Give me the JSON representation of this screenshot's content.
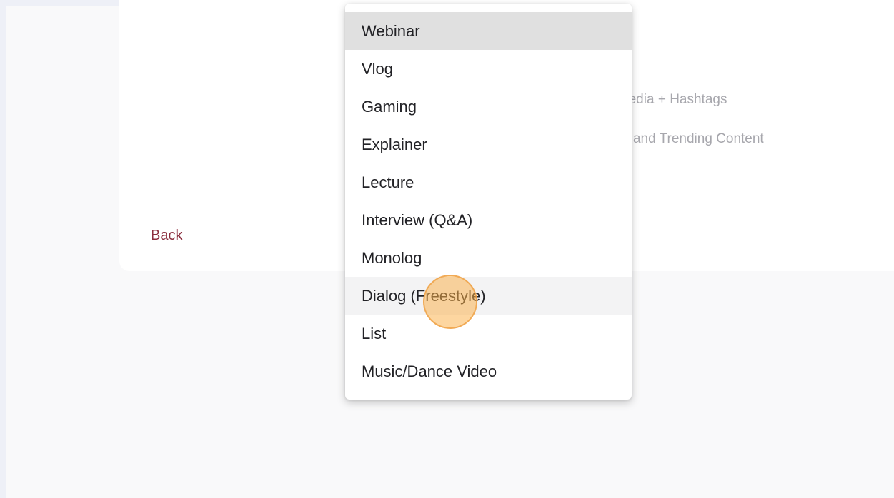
{
  "background": {
    "options": [
      {
        "label": "cial Media + Hashtags"
      },
      {
        "label": "lumes and Trending Content"
      }
    ],
    "back_label": "Back"
  },
  "dropdown": {
    "items": [
      {
        "label": "Webinar",
        "state": "selected"
      },
      {
        "label": "Vlog",
        "state": "normal"
      },
      {
        "label": "Gaming",
        "state": "normal"
      },
      {
        "label": "Explainer",
        "state": "normal"
      },
      {
        "label": "Lecture",
        "state": "normal"
      },
      {
        "label": "Interview (Q&A)",
        "state": "normal"
      },
      {
        "label": "Monolog",
        "state": "normal"
      },
      {
        "label": "Dialog (Freestyle)",
        "state": "hovered"
      },
      {
        "label": "List",
        "state": "normal"
      },
      {
        "label": "Music/Dance Video",
        "state": "normal"
      }
    ]
  },
  "colors": {
    "page_background": "#eef0f7",
    "content_background": "#f9f9fa",
    "card_background": "#ffffff",
    "back_link": "#8b2d3d",
    "selected_item": "#e0e0e0",
    "hovered_item": "#f3f3f4",
    "click_indicator": "#fbb048"
  }
}
